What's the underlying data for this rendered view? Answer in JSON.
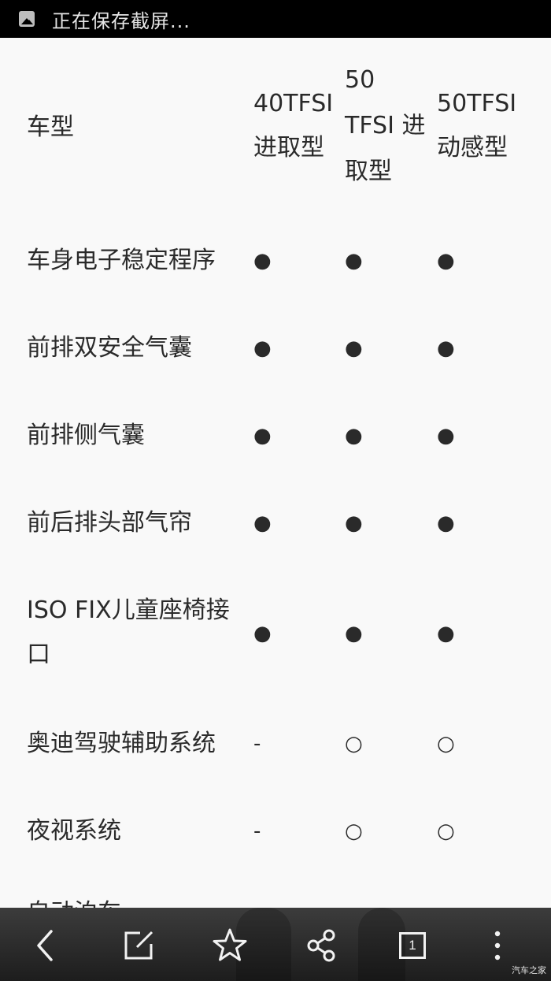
{
  "status_bar": {
    "text": "正在保存截屏..."
  },
  "table": {
    "header": {
      "label": "车型",
      "col1": [
        "40TFSI",
        "进取型"
      ],
      "col2": [
        "50",
        "TFSI 进",
        "取型"
      ],
      "col3": [
        "50TFSI",
        "动感型"
      ]
    },
    "rows": [
      {
        "label": [
          "车身电子稳定程序"
        ],
        "values": [
          "●",
          "●",
          "●"
        ]
      },
      {
        "label": [
          "前排双安全气囊"
        ],
        "values": [
          "●",
          "●",
          "●"
        ]
      },
      {
        "label": [
          "前排侧气囊"
        ],
        "values": [
          "●",
          "●",
          "●"
        ]
      },
      {
        "label": [
          "前后排头部气帘"
        ],
        "values": [
          "●",
          "●",
          "●"
        ]
      },
      {
        "label": [
          "ISO FIX儿童座椅接",
          "口"
        ],
        "values": [
          "●",
          "●",
          "●"
        ]
      },
      {
        "label": [
          "奥迪驾驶辅助系统"
        ],
        "values": [
          "-",
          "○",
          "○"
        ]
      },
      {
        "label": [
          "夜视系统"
        ],
        "values": [
          "-",
          "○",
          "○"
        ]
      },
      {
        "label": [
          "自动泊车"
        ],
        "values": [
          "",
          "",
          ""
        ]
      }
    ]
  },
  "bottom_bar": {
    "buttons": [
      {
        "name": "back-button",
        "icon": "chevron-left-icon"
      },
      {
        "name": "edit-button",
        "icon": "edit-icon"
      },
      {
        "name": "favorite-button",
        "icon": "star-icon"
      },
      {
        "name": "share-button",
        "icon": "share-icon"
      },
      {
        "name": "tabs-button",
        "icon": "tabs-count-icon",
        "count": "1"
      },
      {
        "name": "menu-button",
        "icon": "more-vertical-icon"
      }
    ],
    "watermark": "汽车之家"
  }
}
